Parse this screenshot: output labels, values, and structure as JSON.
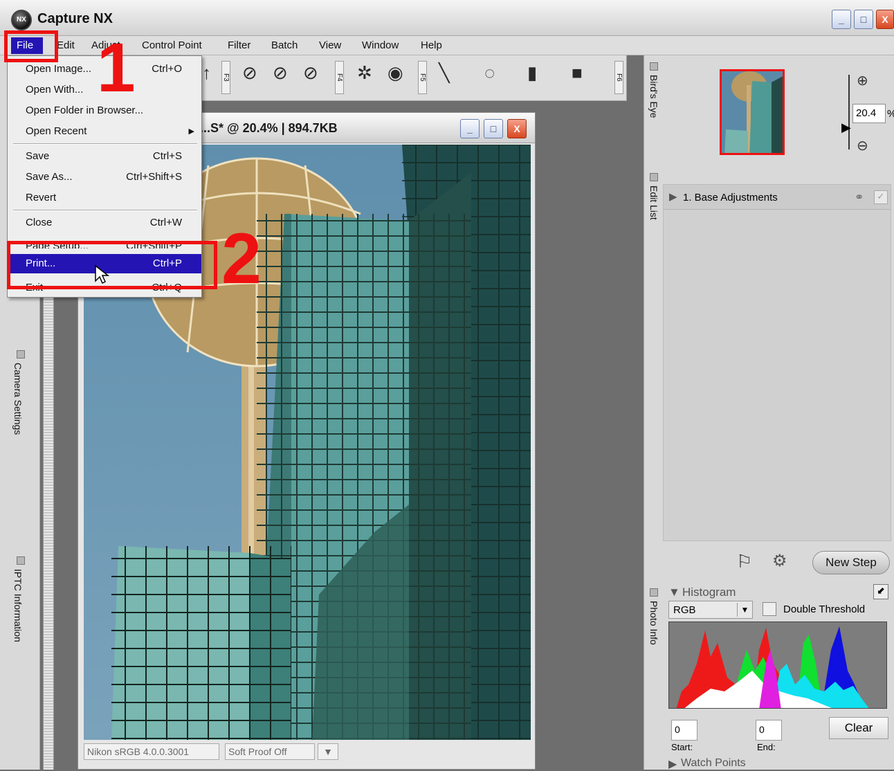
{
  "window": {
    "title": "Capture NX",
    "buttons": [
      "_",
      "□",
      "X"
    ]
  },
  "menubar": {
    "items": [
      "File",
      "Edit",
      "Adjust",
      "Control Point",
      "Filter",
      "Batch",
      "View",
      "Window",
      "Help"
    ]
  },
  "file_menu": {
    "items": [
      {
        "label": "Open Image...",
        "shortcut": "Ctrl+O"
      },
      {
        "label": "Open With...",
        "shortcut": ""
      },
      {
        "label": "Open Folder in Browser...",
        "shortcut": ""
      },
      {
        "label": "Open Recent",
        "shortcut": "▶"
      },
      {
        "label": "Save",
        "shortcut": "Ctrl+S"
      },
      {
        "label": "Save As...",
        "shortcut": "Ctrl+Shift+S"
      },
      {
        "label": "Revert",
        "shortcut": ""
      },
      {
        "label": "Close",
        "shortcut": "Ctrl+W"
      },
      {
        "label": "Page Setup...",
        "shortcut": "Ctrl+Shift+P"
      },
      {
        "label": "Print...",
        "shortcut": "Ctrl+P"
      },
      {
        "label": "Exit",
        "shortcut": "Ctrl+Q"
      }
    ]
  },
  "toolbar": {
    "fkeys": [
      "F3",
      "F4",
      "F5",
      "F6"
    ]
  },
  "image_window": {
    "title": "...S* @ 20.4% | 894.7KB",
    "color_profile": "Nikon sRGB 4.0.0.3001",
    "soft_proof": "Soft Proof Off"
  },
  "left_panel": {
    "sections": [
      "Camera Settings",
      "IPTC Information"
    ]
  },
  "right_panel": {
    "birds_eye_label": "Bird's Eye",
    "zoom_value": "20.4",
    "zoom_unit": "%",
    "edit_list_label": "Edit List",
    "step_label": "1. Base Adjustments",
    "new_step_label": "New Step",
    "photo_info_label": "Photo Info",
    "histogram_label": "Histogram",
    "channel_value": "RGB",
    "double_threshold_label": "Double Threshold",
    "start_value": "0",
    "end_value": "0",
    "start_label": "Start:",
    "end_label": "End:",
    "clear_label": "Clear",
    "watch_points_label": "Watch Points"
  },
  "annotations": {
    "step1": "1",
    "step2": "2",
    "highlight_color": "#ee1111"
  },
  "colors": {
    "menu_highlight": "#2414b4"
  }
}
